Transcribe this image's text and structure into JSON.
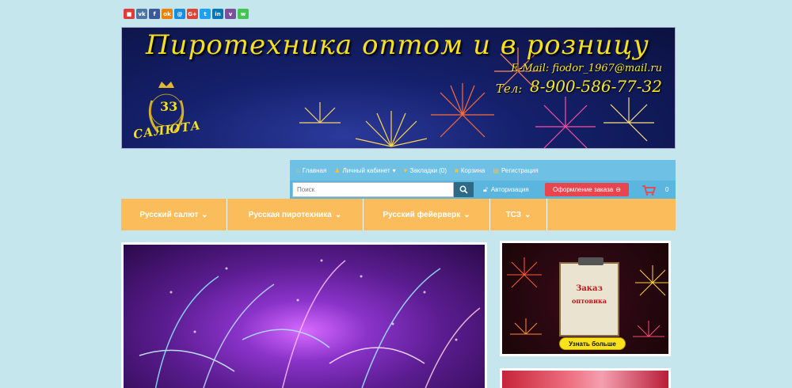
{
  "share": {
    "buttons": [
      {
        "name": "bookmark",
        "glyph": "■",
        "color": "#e03b3b"
      },
      {
        "name": "vk",
        "glyph": "vk",
        "color": "#4c75a3"
      },
      {
        "name": "facebook",
        "glyph": "f",
        "color": "#3b5998"
      },
      {
        "name": "odnoklassniki",
        "glyph": "ok",
        "color": "#ee8208"
      },
      {
        "name": "moimir",
        "glyph": "@",
        "color": "#168de2"
      },
      {
        "name": "googleplus",
        "glyph": "G+",
        "color": "#db4437"
      },
      {
        "name": "twitter",
        "glyph": "t",
        "color": "#1da1f2"
      },
      {
        "name": "linkedin",
        "glyph": "in",
        "color": "#0077b5"
      },
      {
        "name": "viber",
        "glyph": "v",
        "color": "#7b519d"
      },
      {
        "name": "whatsapp",
        "glyph": "w",
        "color": "#43c553"
      }
    ]
  },
  "banner": {
    "title": "Пиротехника оптом и в розницу",
    "email": "E-Mail: fiodor_1967@mail.ru",
    "phone_label": "Тел:",
    "phone": "8-900-586-77-32",
    "logo_number": "33",
    "logo_word": "САЛЮТА"
  },
  "toplinks": {
    "home": "Главная",
    "account": "Личный кабинет",
    "bookmarks": "Закладки (0)",
    "cart": "Корзина",
    "register": "Регистрация"
  },
  "search": {
    "placeholder": "Поиск"
  },
  "auth": {
    "label": "Авторизация"
  },
  "order": {
    "label": "Оформление заказа"
  },
  "cart": {
    "count": "0"
  },
  "nav": [
    {
      "label": "Русский салют"
    },
    {
      "label": "Русская пиротехника"
    },
    {
      "label": "Русский фейерверк"
    },
    {
      "label": "ТСЗ"
    }
  ],
  "promo": {
    "line1": "Заказ",
    "line2": "оптовика",
    "button": "Узнать больше"
  },
  "colors": {
    "page_bg": "#c6e6ee",
    "toplinks_bg": "#6ec1e4",
    "nav_bg": "#fbbd5c",
    "order_btn": "#e8454e",
    "banner_text": "#f5df1f"
  }
}
